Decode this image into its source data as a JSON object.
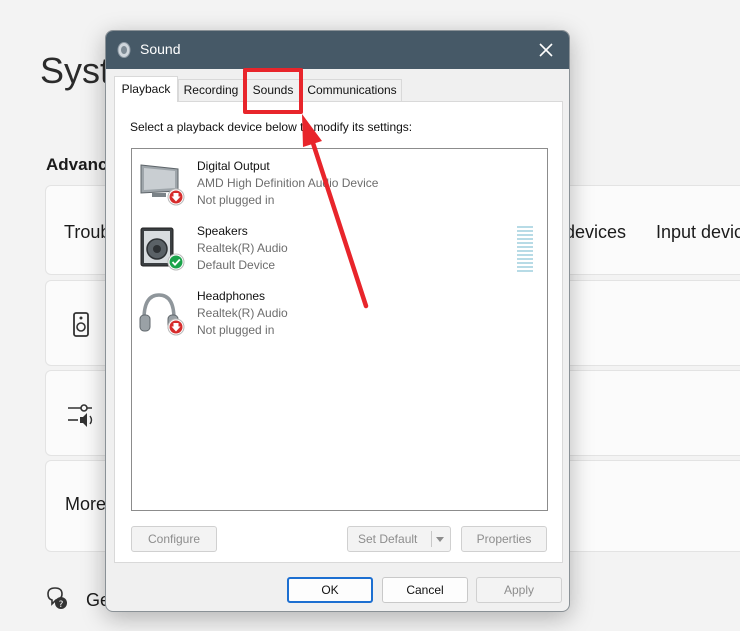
{
  "background": {
    "title": "Syst",
    "section": "Advanc",
    "troubleshoot": "Troub",
    "output_devices": "devices",
    "input_devices": "Input devic",
    "more": "More",
    "get_help": "Ge"
  },
  "dialog": {
    "title": "Sound",
    "tabs": [
      {
        "label": "Playback",
        "selected": true
      },
      {
        "label": "Recording"
      },
      {
        "label": "Sounds"
      },
      {
        "label": "Communications"
      }
    ],
    "instruction": "Select a playback device below to modify its settings:",
    "devices": [
      {
        "name": "Digital Output",
        "description": "AMD High Definition Audio Device",
        "status": "Not plugged in",
        "icon": "monitor-icon"
      },
      {
        "name": "Speakers",
        "description": "Realtek(R) Audio",
        "status": "Default Device",
        "icon": "speaker-icon"
      },
      {
        "name": "Headphones",
        "description": "Realtek(R) Audio",
        "status": "Not plugged in",
        "icon": "headphones-icon"
      }
    ],
    "buttons": {
      "configure": "Configure",
      "set_default": "Set Default",
      "properties": "Properties",
      "ok": "OK",
      "cancel": "Cancel",
      "apply": "Apply"
    }
  },
  "colors": {
    "titlebar": "#465967",
    "annotation": "#e8252b",
    "ok_border": "#1d6fd1",
    "status_default": "#1aa34a",
    "status_unplugged": "#d62b2b"
  }
}
